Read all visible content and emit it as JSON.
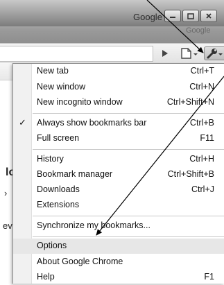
{
  "window": {
    "title_text": "Google",
    "watermark_text": "Google"
  },
  "menu": {
    "items": [
      {
        "label": "New tab",
        "shortcut": "Ctrl+T"
      },
      {
        "label": "New window",
        "shortcut": "Ctrl+N"
      },
      {
        "label": "New incognito window",
        "shortcut": "Ctrl+Shift+N"
      },
      {
        "label": "Always show bookmarks bar",
        "shortcut": "Ctrl+B",
        "checked": true
      },
      {
        "label": "Full screen",
        "shortcut": "F11"
      },
      {
        "label": "History",
        "shortcut": "Ctrl+H"
      },
      {
        "label": "Bookmark manager",
        "shortcut": "Ctrl+Shift+B"
      },
      {
        "label": "Downloads",
        "shortcut": "Ctrl+J"
      },
      {
        "label": "Extensions",
        "shortcut": ""
      },
      {
        "label": "Synchronize my bookmarks...",
        "shortcut": ""
      },
      {
        "label": "Options",
        "shortcut": "",
        "highlighted": true
      },
      {
        "label": "About Google Chrome",
        "shortcut": ""
      },
      {
        "label": "Help",
        "shortcut": "F1"
      }
    ],
    "check_glyph": "✓"
  },
  "page_fragments": {
    "frag1": "lo",
    "frag2": "›",
    "frag3": "ev"
  },
  "icons": {
    "toolbar": [
      "play-icon",
      "page-menu-icon",
      "wrench-icon"
    ],
    "window": [
      "minimize-icon",
      "maximize-icon",
      "close-icon"
    ]
  },
  "colors": {
    "frame": "#9a9a9a",
    "menu_background": "#ffffff",
    "highlight": "#e7e7e7",
    "arrow": "#000000"
  }
}
